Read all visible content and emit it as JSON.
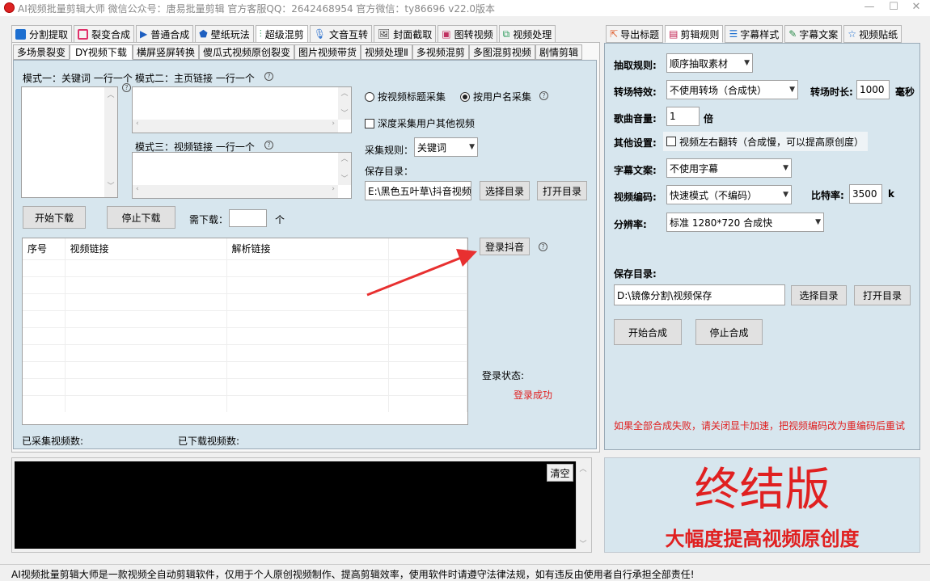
{
  "titlebar": {
    "title": "AI视频批量剪辑大师   微信公众号：唐易批量剪辑   官方客服QQ：2642468954   官方微信：ty86696    v22.0版本"
  },
  "main_tabs": [
    "分割提取",
    "裂变合成",
    "普通合成",
    "壁纸玩法",
    "超级混剪",
    "文音互转",
    "封面截取",
    "图转视频",
    "视频处理"
  ],
  "sub_tabs": [
    "多场景裂变",
    "DY视频下载",
    "横屏竖屏转换",
    "傻瓜式视频原创裂变",
    "图片视频带货",
    "视频处理Ⅱ",
    "多视频混剪",
    "多图混剪视频",
    "剧情剪辑"
  ],
  "left": {
    "mode1": "模式一：关键词 一行一个",
    "mode2": "模式二：主页链接 一行一个",
    "mode3": "模式三：视频链接 一行一个",
    "radio1": "按视频标题采集",
    "radio2": "按用户名采集",
    "deep_check": "深度采集用户其他视频",
    "rule_label": "采集规则：",
    "rule_value": "关键词",
    "save_label": "保存目录：",
    "save_path": "E:\\黑色五叶草\\抖音视频",
    "choose_dir": "选择目录",
    "open_dir": "打开目录",
    "start": "开始下载",
    "stop": "停止下载",
    "need_label": "需下载：",
    "unit": "个",
    "cols": [
      "序号",
      "视频链接",
      "解析链接"
    ],
    "login_btn": "登录抖音",
    "login_state": "登录状态:",
    "login_result": "登录成功",
    "collected": "已采集视频数:",
    "downloaded": "已下载视频数:",
    "clear": "清空"
  },
  "right_tabs": [
    "导出标题",
    "剪辑规则",
    "字幕样式",
    "字幕文案",
    "视频贴纸"
  ],
  "right": {
    "extract_label": "抽取规则:",
    "extract_value": "顺序抽取素材",
    "trans_label": "转场特效:",
    "trans_value": "不使用转场（合成快）",
    "dur_label": "转场时长:",
    "dur_value": "1000",
    "dur_unit": "毫秒",
    "vol_label": "歌曲音量:",
    "vol_value": "1",
    "vol_unit": "倍",
    "other_label": "其他设置:",
    "flip": "视频左右翻转（合成慢，可以提高原创度）",
    "sub_label": "字幕文案:",
    "sub_value": "不使用字幕",
    "codec_label": "视频编码:",
    "codec_value": "快速模式（不编码）",
    "bit_label": "比特率:",
    "bit_value": "3500",
    "bit_unit": "k",
    "res_label": "分辨率:",
    "res_value": "标准 1280*720 合成快",
    "save_label": "保存目录:",
    "save_path": "D:\\镜像分割\\视频保存",
    "choose": "选择目录",
    "open": "打开目录",
    "start": "开始合成",
    "stop": "停止合成",
    "warn": "如果全部合成失败，请关闭显卡加速，把视频编码改为重编码后重试"
  },
  "banner": {
    "title": "终结版",
    "subtitle": "大幅度提高视频原创度"
  },
  "status": "AI视频批量剪辑大师是一款视频全自动剪辑软件，仅用于个人原创视频制作、提高剪辑效率，使用软件时请遵守法律法规，如有违反由使用者自行承担全部责任!",
  "colors": {
    "accent": "#e02020",
    "panel": "#d7e6ee",
    "log": "#000000"
  }
}
